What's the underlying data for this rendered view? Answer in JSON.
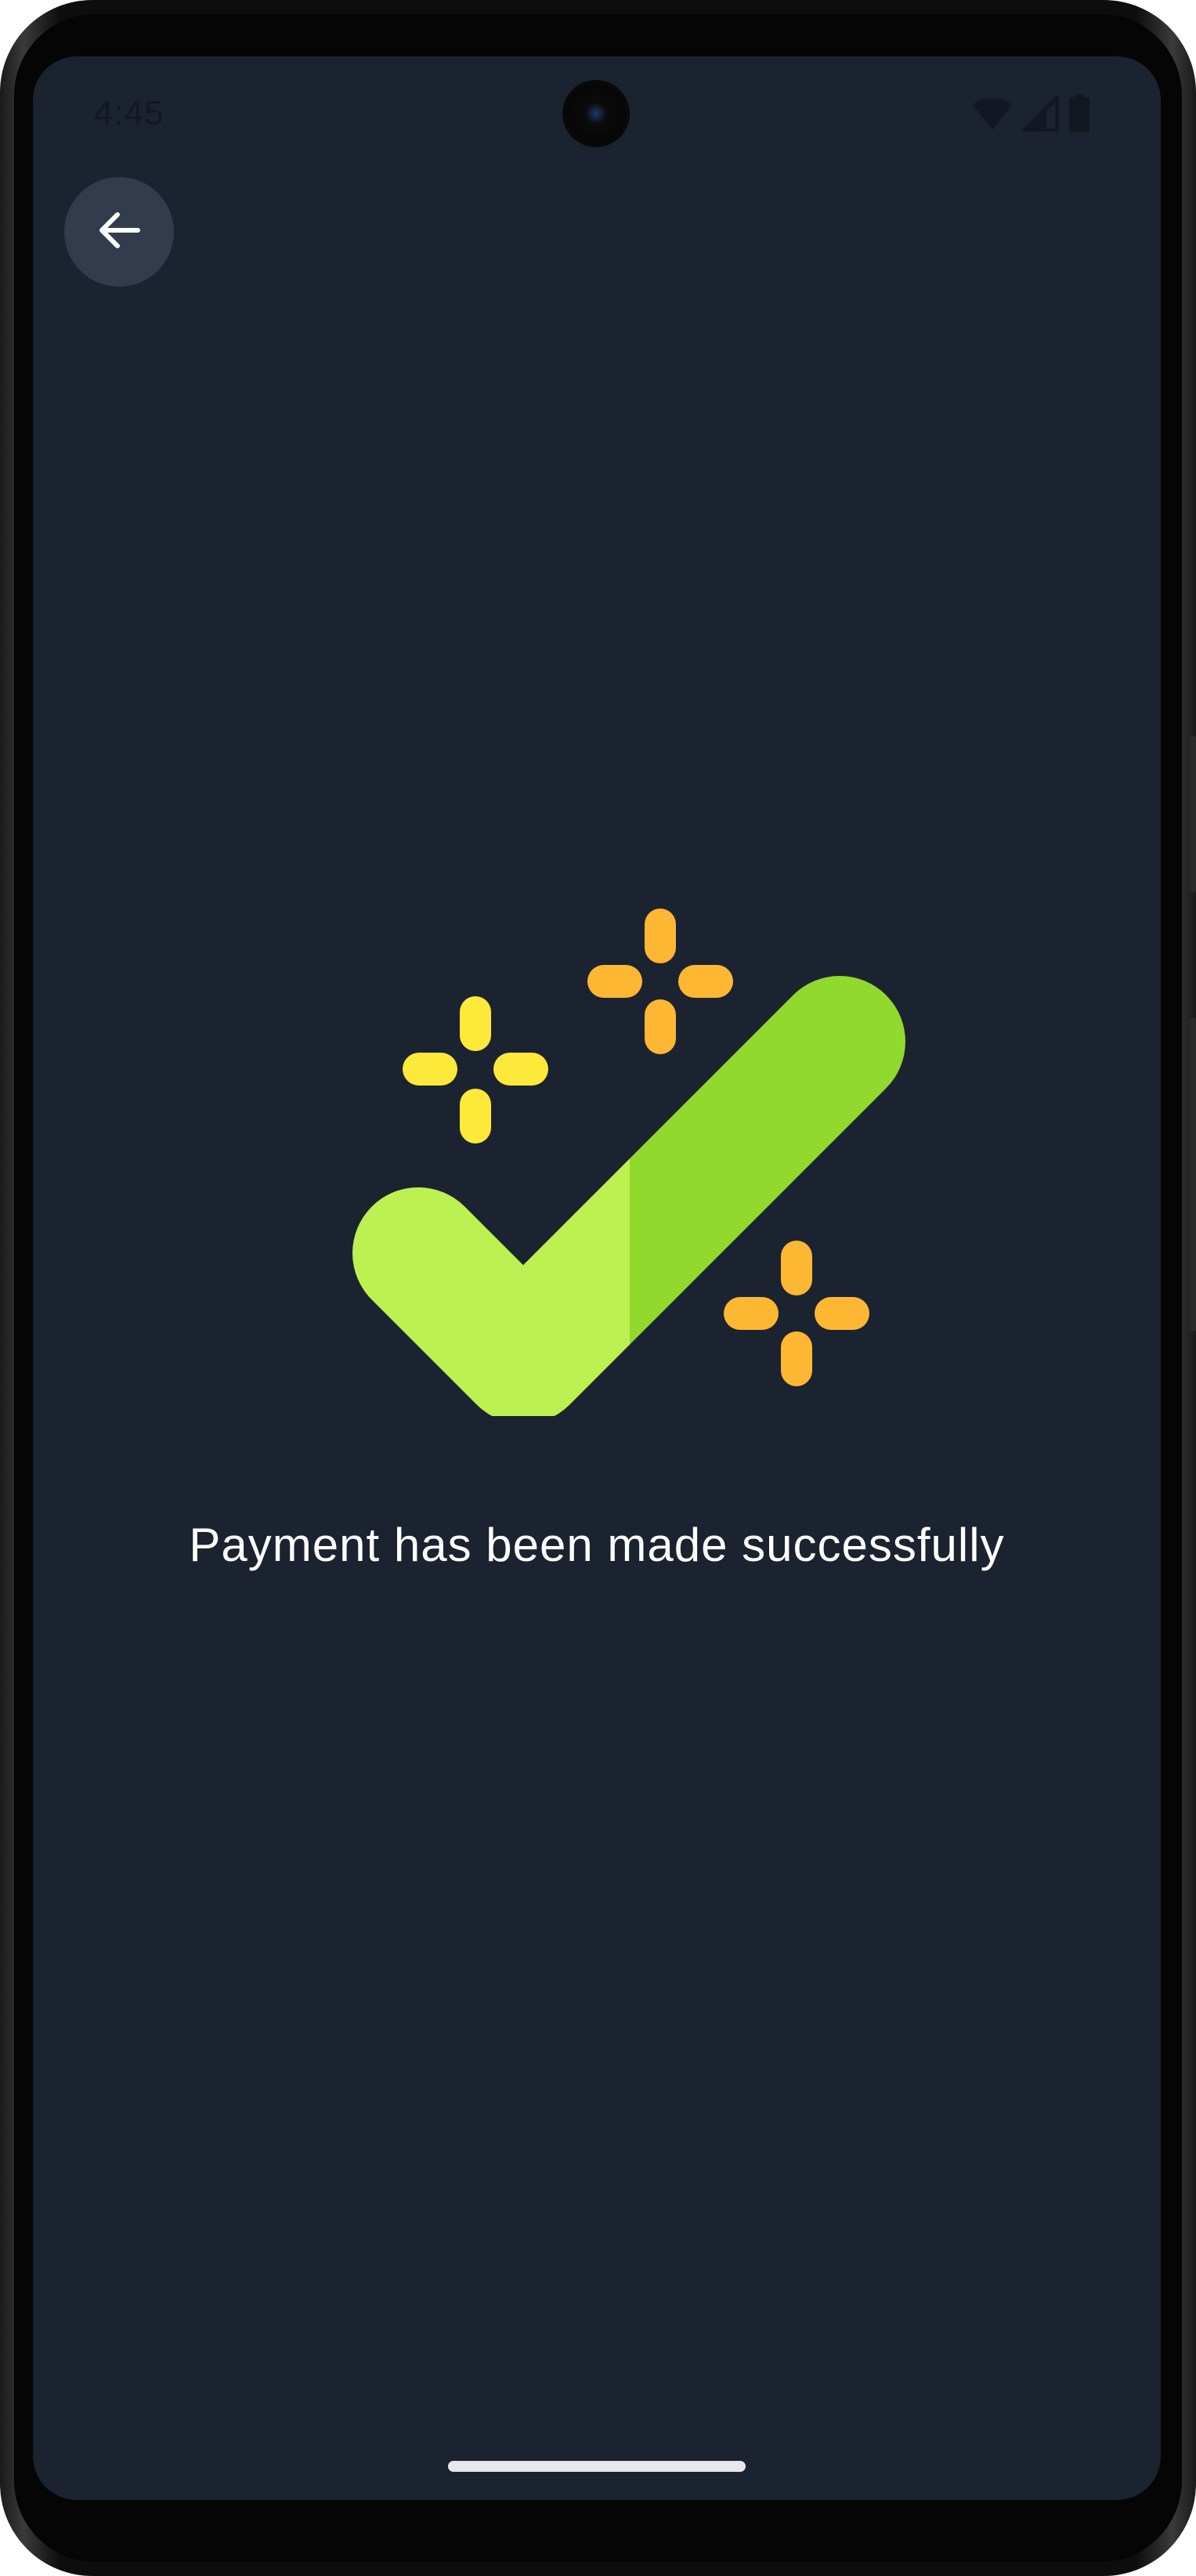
{
  "status_bar": {
    "time": "4:45",
    "icons": [
      "wifi-icon",
      "signal-icon",
      "battery-icon"
    ]
  },
  "navigation": {
    "back_icon": "arrow-left-icon"
  },
  "content": {
    "illustration": "success-checkmark-icon",
    "message": "Payment has been made successfully"
  },
  "colors": {
    "background": "#1b2330",
    "back_button_bg": "#323c4c",
    "check_light": "#bdf051",
    "check_dark": "#91d82f",
    "sparkle_yellow": "#fde93a",
    "sparkle_orange": "#fdb733",
    "text": "#ffffff"
  }
}
